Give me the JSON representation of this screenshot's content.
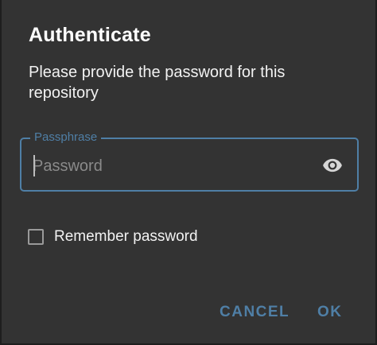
{
  "dialog": {
    "title": "Authenticate",
    "message": "Please provide the password for this repository",
    "field": {
      "label": "Passphrase",
      "placeholder": "Password",
      "value": "",
      "toggle_icon": "eye-icon"
    },
    "remember": {
      "label": "Remember password",
      "checked": false
    },
    "buttons": {
      "cancel": "CANCEL",
      "ok": "OK"
    }
  },
  "colors": {
    "background": "#333333",
    "accent": "#4f7fa6",
    "text": "#ffffff",
    "placeholder": "#8a8a8a"
  }
}
